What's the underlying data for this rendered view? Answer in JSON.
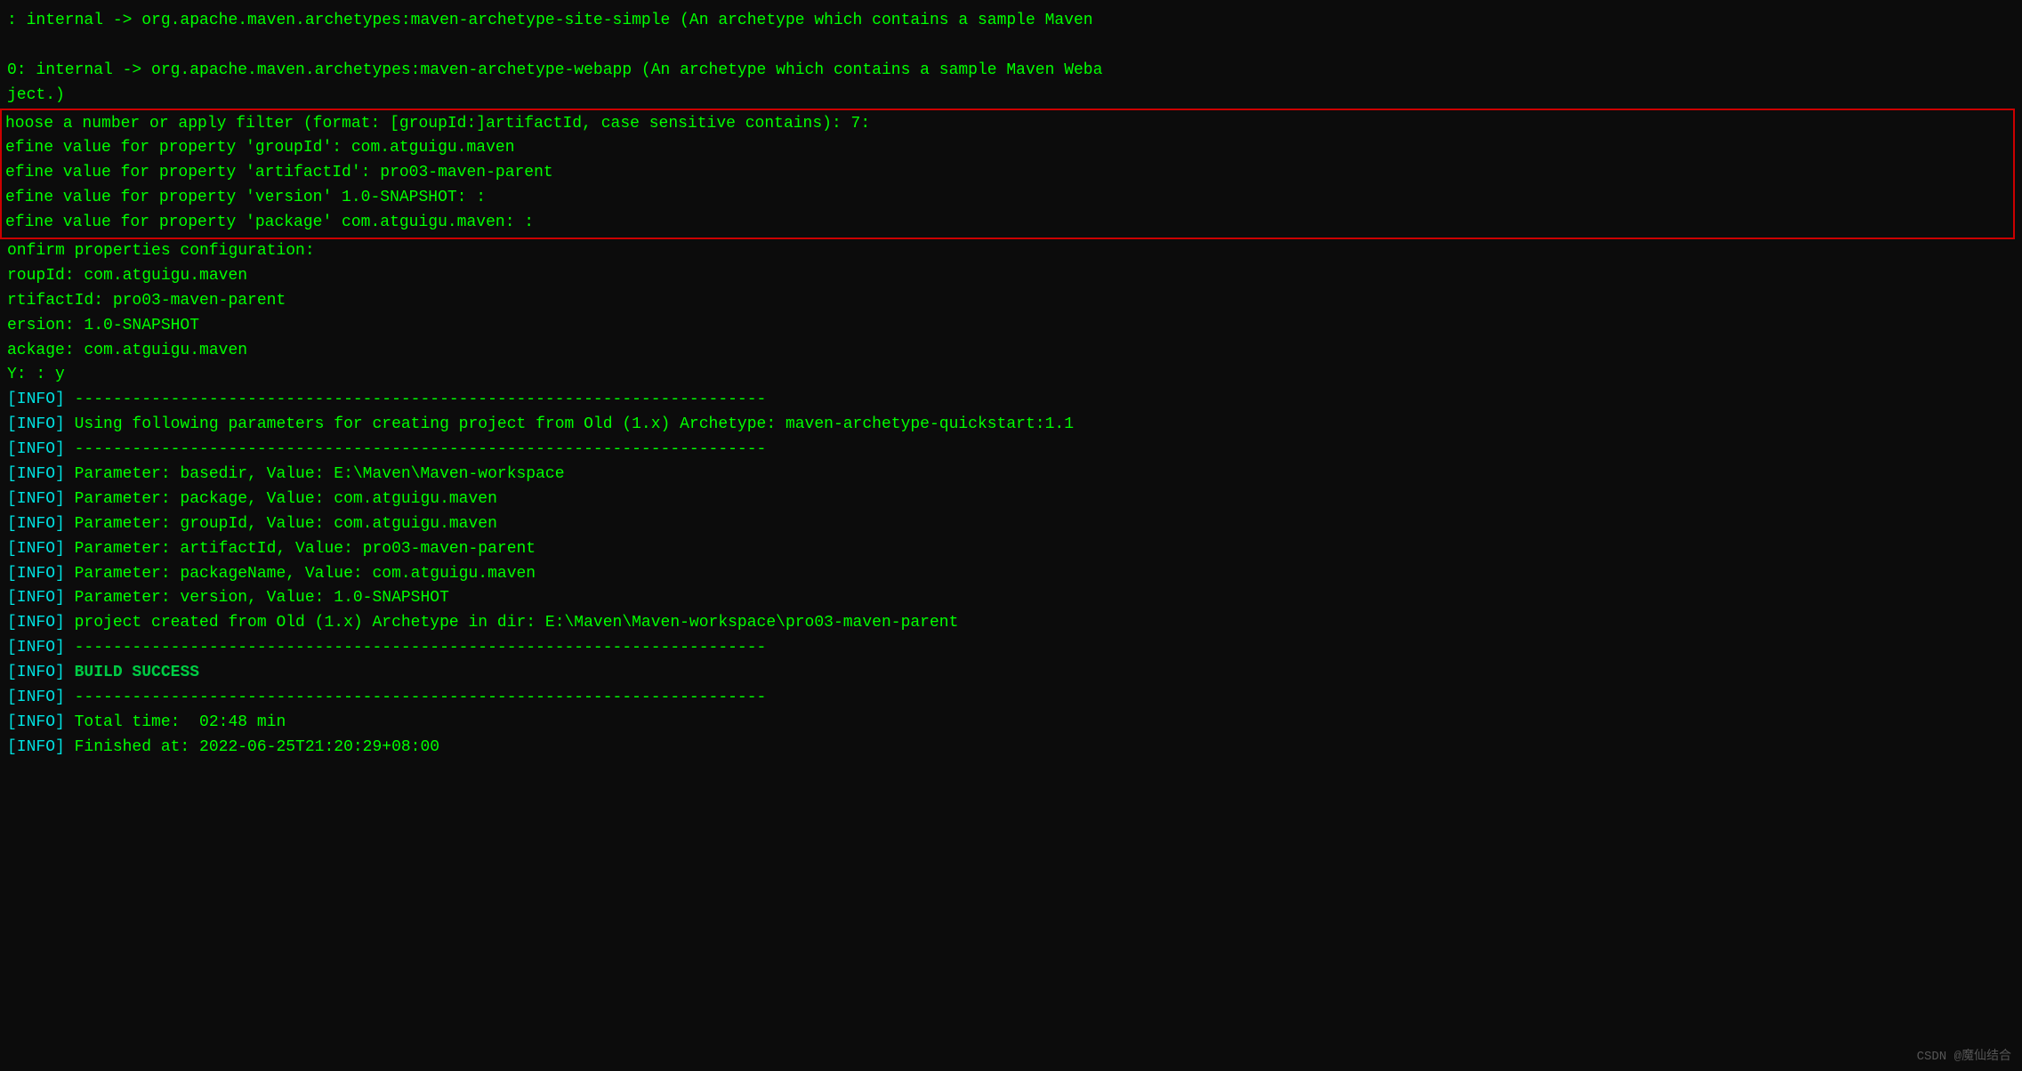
{
  "terminal": {
    "lines": [
      {
        "id": "line1",
        "text": ": internal -> org.apache.maven.archetypes:maven-archetype-site-simple (An archetype which contains a sample Maven",
        "type": "green"
      },
      {
        "id": "line2",
        "text": "",
        "type": "green"
      },
      {
        "id": "line3",
        "text": "0: internal -> org.apache.maven.archetypes:maven-archetype-webapp (An archetype which contains a sample Maven Weba",
        "type": "green"
      },
      {
        "id": "line4",
        "text": "ject.)",
        "type": "green"
      },
      {
        "id": "line5_highlighted",
        "text": "hoose a number or apply filter (format: [groupId:]artifactId, case sensitive contains): 7:",
        "type": "green",
        "highlight": true
      },
      {
        "id": "line6_highlighted",
        "text": "efine value for property 'groupId': com.atguigu.maven",
        "type": "green",
        "highlight": true
      },
      {
        "id": "line7_highlighted",
        "text": "efine value for property 'artifactId': pro03-maven-parent",
        "type": "green",
        "highlight": true
      },
      {
        "id": "line8_highlighted",
        "text": "efine value for property 'version' 1.0-SNAPSHOT: :",
        "type": "green",
        "highlight": true
      },
      {
        "id": "line9_highlighted",
        "text": "efine value for property 'package' com.atguigu.maven: :",
        "type": "green",
        "highlight": true
      },
      {
        "id": "line10",
        "text": "onfirm properties configuration:",
        "type": "green"
      },
      {
        "id": "line11",
        "text": "roupId: com.atguigu.maven",
        "type": "green"
      },
      {
        "id": "line12",
        "text": "rtifactId: pro03-maven-parent",
        "type": "green"
      },
      {
        "id": "line13",
        "text": "ersion: 1.0-SNAPSHOT",
        "type": "green"
      },
      {
        "id": "line14",
        "text": "ackage: com.atguigu.maven",
        "type": "green"
      },
      {
        "id": "line15",
        "text": "Y: : y",
        "type": "green"
      },
      {
        "id": "line16",
        "text": "[INFO] ------------------------------------------------------------------------",
        "type": "info"
      },
      {
        "id": "line17",
        "text": "[INFO] Using following parameters for creating project from Old (1.x) Archetype: maven-archetype-quickstart:1.1",
        "type": "info"
      },
      {
        "id": "line18",
        "text": "[INFO] ------------------------------------------------------------------------",
        "type": "info"
      },
      {
        "id": "line19",
        "text": "[INFO] Parameter: basedir, Value: E:\\Maven\\Maven-workspace",
        "type": "info"
      },
      {
        "id": "line20",
        "text": "[INFO] Parameter: package, Value: com.atguigu.maven",
        "type": "info"
      },
      {
        "id": "line21",
        "text": "[INFO] Parameter: groupId, Value: com.atguigu.maven",
        "type": "info"
      },
      {
        "id": "line22",
        "text": "[INFO] Parameter: artifactId, Value: pro03-maven-parent",
        "type": "info"
      },
      {
        "id": "line23",
        "text": "[INFO] Parameter: packageName, Value: com.atguigu.maven",
        "type": "info"
      },
      {
        "id": "line24",
        "text": "[INFO] Parameter: version, Value: 1.0-SNAPSHOT",
        "type": "info"
      },
      {
        "id": "line25",
        "text": "[INFO] project created from Old (1.x) Archetype in dir: E:\\Maven\\Maven-workspace\\pro03-maven-parent",
        "type": "info"
      },
      {
        "id": "line26",
        "text": "[INFO] ------------------------------------------------------------------------",
        "type": "info"
      },
      {
        "id": "line27_success",
        "text": "[INFO] BUILD SUCCESS",
        "type": "success"
      },
      {
        "id": "line28",
        "text": "[INFO] ------------------------------------------------------------------------",
        "type": "info"
      },
      {
        "id": "line29",
        "text": "[INFO] Total time:  02:48 min",
        "type": "info"
      },
      {
        "id": "line30",
        "text": "[INFO] Finished at: 2022-06-25T21:20:29+08:00",
        "type": "info"
      }
    ]
  },
  "watermark": {
    "text": "CSDN @魔仙结合"
  }
}
